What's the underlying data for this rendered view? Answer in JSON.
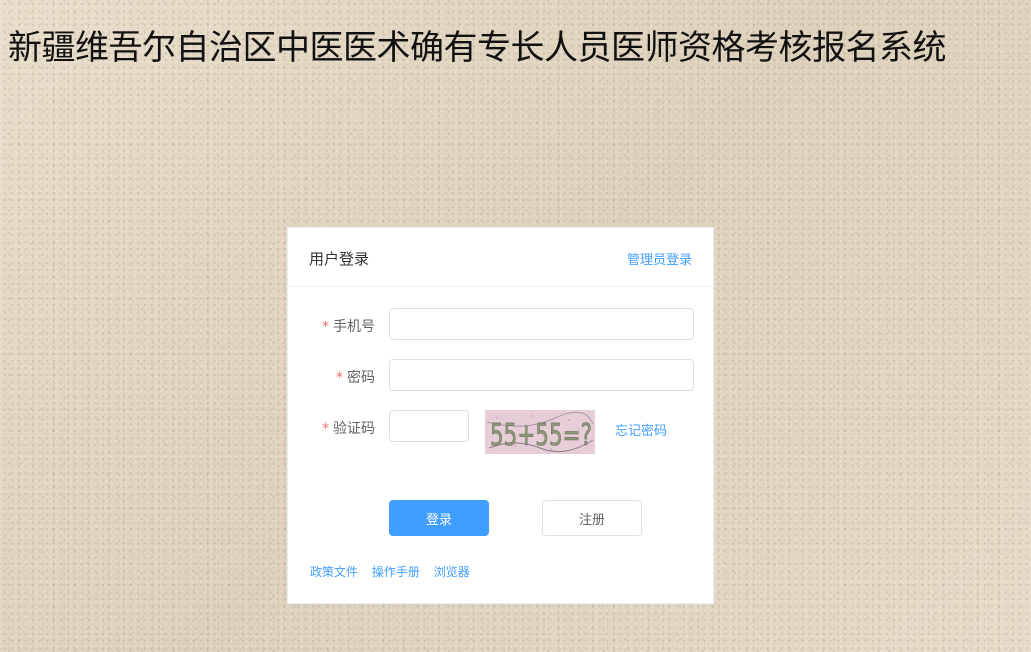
{
  "page": {
    "title": "新疆维吾尔自治区中医医术确有专长人员医师资格考核报名系统"
  },
  "login_card": {
    "title": "用户登录",
    "admin_login_link": "管理员登录",
    "fields": {
      "phone": {
        "label": "手机号",
        "value": "",
        "required_mark": "*"
      },
      "password": {
        "label": "密码",
        "value": "",
        "required_mark": "*"
      },
      "captcha": {
        "label": "验证码",
        "value": "",
        "required_mark": "*",
        "captcha_text": "55+55=?"
      }
    },
    "forgot_password_link": "忘记密码",
    "login_button": "登录",
    "register_button": "注册",
    "footer_links": [
      "政策文件",
      "操作手册",
      "浏览器"
    ]
  },
  "colors": {
    "primary": "#409eff",
    "required": "#f56c6c",
    "card_bg": "#ffffff",
    "page_bg": "#e4d8c4"
  }
}
